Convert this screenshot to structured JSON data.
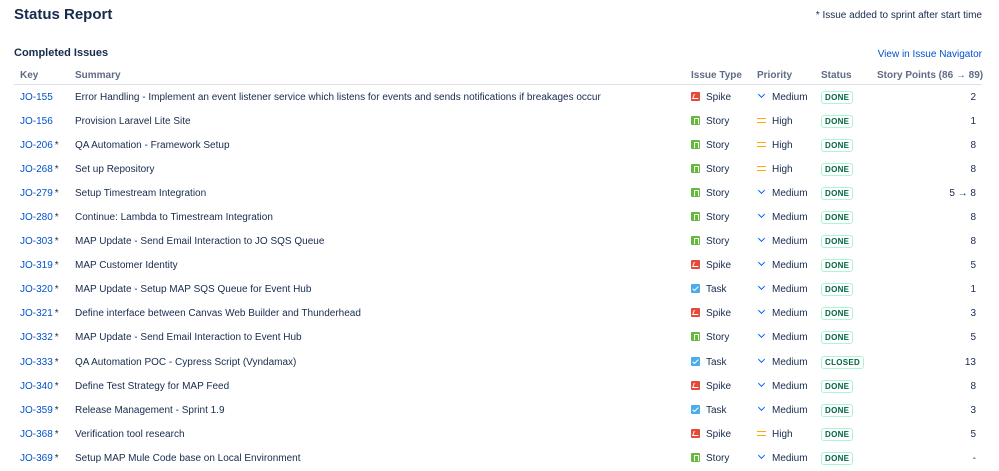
{
  "header": {
    "title": "Status Report",
    "sprint_note": "* Issue added to sprint after start time"
  },
  "section": {
    "title": "Completed Issues",
    "navigator_link": "View in Issue Navigator"
  },
  "columns": {
    "key": "Key",
    "summary": "Summary",
    "type": "Issue Type",
    "priority": "Priority",
    "status": "Status",
    "points": "Story Points (86 → 89)"
  },
  "colors": {
    "link": "#0052cc",
    "spike": "#e5493a",
    "story": "#63ba3c",
    "task": "#4bade8",
    "priority_medium": "#0065ff",
    "priority_high": "#ffab00",
    "done_text": "#006644"
  },
  "rows": [
    {
      "key": "JO-155",
      "added": "",
      "summary": "Error Handling - Implement an event listener service which listens for events and sends notifications if breakages occur",
      "type": "Spike",
      "type_icon": "spike-icon",
      "priority": "Medium",
      "priority_icon": "priority-medium-icon",
      "status": "DONE",
      "points": "2"
    },
    {
      "key": "JO-156",
      "added": "",
      "summary": "Provision Laravel Lite Site",
      "type": "Story",
      "type_icon": "story-icon",
      "priority": "High",
      "priority_icon": "priority-high-icon",
      "status": "DONE",
      "points": "1"
    },
    {
      "key": "JO-206",
      "added": "*",
      "summary": "QA Automation - Framework Setup",
      "type": "Story",
      "type_icon": "story-icon",
      "priority": "High",
      "priority_icon": "priority-high-icon",
      "status": "DONE",
      "points": "8"
    },
    {
      "key": "JO-268",
      "added": "*",
      "summary": "Set up Repository",
      "type": "Story",
      "type_icon": "story-icon",
      "priority": "High",
      "priority_icon": "priority-high-icon",
      "status": "DONE",
      "points": "8"
    },
    {
      "key": "JO-279",
      "added": "*",
      "summary": "Setup Timestream Integration",
      "type": "Story",
      "type_icon": "story-icon",
      "priority": "Medium",
      "priority_icon": "priority-medium-icon",
      "status": "DONE",
      "points": "5 → 8"
    },
    {
      "key": "JO-280",
      "added": "*",
      "summary": "Continue: Lambda to Timestream Integration",
      "type": "Story",
      "type_icon": "story-icon",
      "priority": "Medium",
      "priority_icon": "priority-medium-icon",
      "status": "DONE",
      "points": "8"
    },
    {
      "key": "JO-303",
      "added": "*",
      "summary": "MAP Update - Send Email Interaction to JO SQS Queue",
      "type": "Story",
      "type_icon": "story-icon",
      "priority": "Medium",
      "priority_icon": "priority-medium-icon",
      "status": "DONE",
      "points": "8"
    },
    {
      "key": "JO-319",
      "added": "*",
      "summary": "MAP Customer Identity",
      "type": "Spike",
      "type_icon": "spike-icon",
      "priority": "Medium",
      "priority_icon": "priority-medium-icon",
      "status": "DONE",
      "points": "5"
    },
    {
      "key": "JO-320",
      "added": "*",
      "summary": "MAP Update - Setup MAP SQS Queue for Event Hub",
      "type": "Task",
      "type_icon": "task-icon",
      "priority": "Medium",
      "priority_icon": "priority-medium-icon",
      "status": "DONE",
      "points": "1"
    },
    {
      "key": "JO-321",
      "added": "*",
      "summary": "Define interface between Canvas Web Builder and Thunderhead",
      "type": "Spike",
      "type_icon": "spike-icon",
      "priority": "Medium",
      "priority_icon": "priority-medium-icon",
      "status": "DONE",
      "points": "3"
    },
    {
      "key": "JO-332",
      "added": "*",
      "summary": "MAP Update - Send Email Interaction to Event Hub",
      "type": "Story",
      "type_icon": "story-icon",
      "priority": "Medium",
      "priority_icon": "priority-medium-icon",
      "status": "DONE",
      "points": "5"
    },
    {
      "key": "JO-333",
      "added": "*",
      "summary": "QA Automation POC - Cypress Script (Vyndamax)",
      "type": "Task",
      "type_icon": "task-icon",
      "priority": "Medium",
      "priority_icon": "priority-medium-icon",
      "status": "CLOSED",
      "points": "13"
    },
    {
      "key": "JO-340",
      "added": "*",
      "summary": "Define Test Strategy for MAP Feed",
      "type": "Spike",
      "type_icon": "spike-icon",
      "priority": "Medium",
      "priority_icon": "priority-medium-icon",
      "status": "DONE",
      "points": "8"
    },
    {
      "key": "JO-359",
      "added": "*",
      "summary": "Release Management - Sprint 1.9",
      "type": "Task",
      "type_icon": "task-icon",
      "priority": "Medium",
      "priority_icon": "priority-medium-icon",
      "status": "DONE",
      "points": "3"
    },
    {
      "key": "JO-368",
      "added": "*",
      "summary": "Verification tool research",
      "type": "Spike",
      "type_icon": "spike-icon",
      "priority": "High",
      "priority_icon": "priority-high-icon",
      "status": "DONE",
      "points": "5"
    },
    {
      "key": "JO-369",
      "added": "*",
      "summary": "Setup MAP Mule Code base on Local Environment",
      "type": "Story",
      "type_icon": "story-icon",
      "priority": "Medium",
      "priority_icon": "priority-medium-icon",
      "status": "DONE",
      "points": "-"
    }
  ]
}
